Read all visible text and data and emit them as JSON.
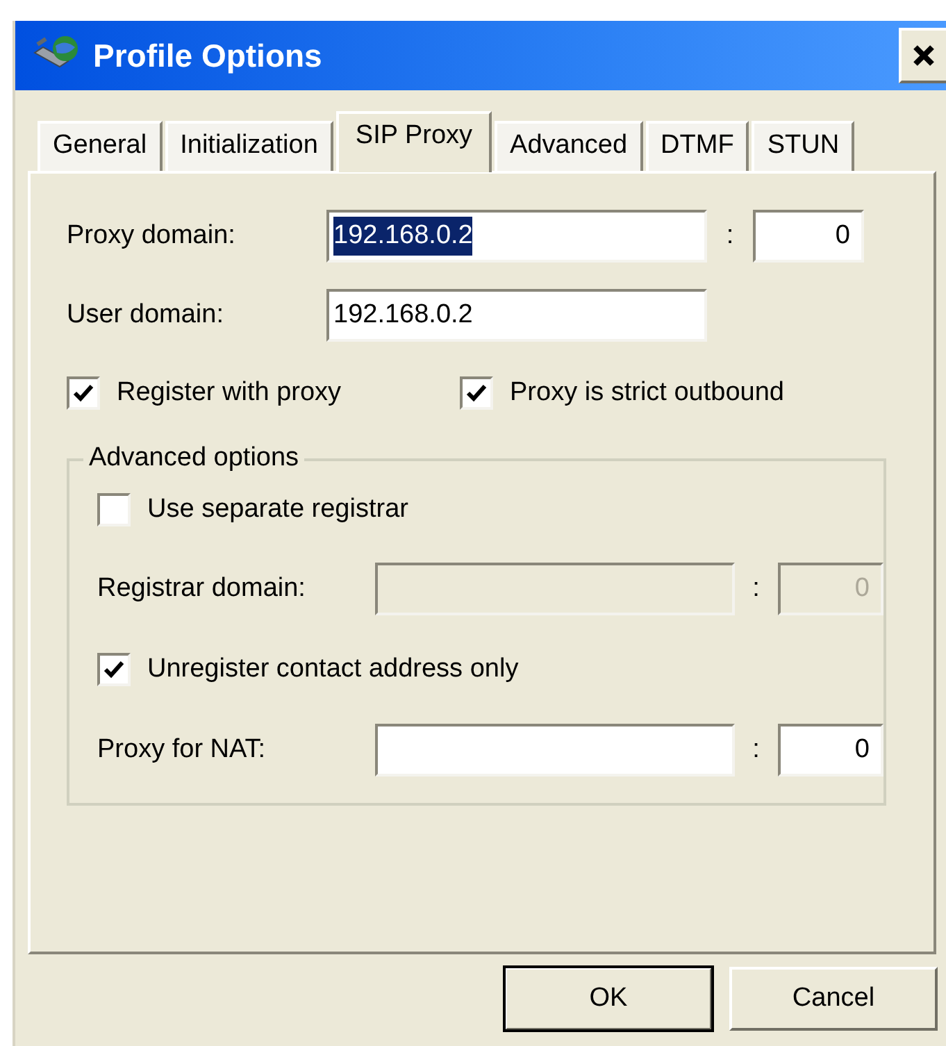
{
  "window": {
    "title": "Profile Options"
  },
  "tabs": [
    {
      "label": "General",
      "selected": false
    },
    {
      "label": "Initialization",
      "selected": false
    },
    {
      "label": "SIP Proxy",
      "selected": true
    },
    {
      "label": "Advanced",
      "selected": false
    },
    {
      "label": "DTMF",
      "selected": false
    },
    {
      "label": "STUN",
      "selected": false
    }
  ],
  "fields": [
    {
      "label": "Proxy domain:",
      "value": "192.168.0.2",
      "value_highlighted": true,
      "separator": ":",
      "port": "0"
    },
    {
      "label": "User domain:",
      "value": "192.168.0.2",
      "value_highlighted": false
    }
  ],
  "checkboxes": [
    {
      "label": "Register with proxy",
      "checked": true
    },
    {
      "label": "Proxy is strict outbound",
      "checked": true
    }
  ],
  "advanced_options": {
    "title": "Advanced options",
    "items": [
      {
        "kind": "checkbox",
        "label": "Use separate registrar",
        "checked": false
      },
      {
        "kind": "field",
        "label": "Registrar domain:",
        "disabled": true,
        "separator": ":",
        "port": "0"
      },
      {
        "kind": "checkbox",
        "label": "Unregister contact address only",
        "checked": true
      },
      {
        "kind": "field",
        "label": "Proxy for NAT:",
        "disabled": false,
        "separator": ":",
        "port": "0"
      }
    ]
  },
  "buttons": [
    {
      "label": "OK",
      "default": true
    },
    {
      "label": "Cancel",
      "default": false
    }
  ]
}
